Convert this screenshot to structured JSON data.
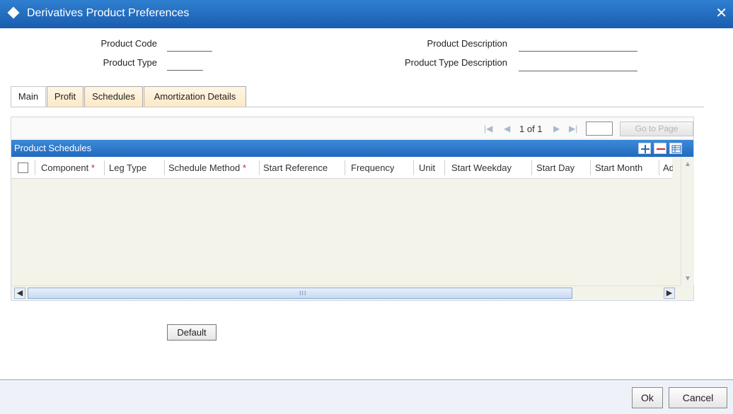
{
  "window": {
    "title": "Derivatives Product Preferences",
    "close_symbol": "✕"
  },
  "header": {
    "product_code_label": "Product Code",
    "product_type_label": "Product Type",
    "product_description_label": "Product Description",
    "product_type_description_label": "Product Type Description"
  },
  "tabs": [
    {
      "label": "Main",
      "active": true
    },
    {
      "label": "Profit",
      "active": false
    },
    {
      "label": "Schedules",
      "active": false
    },
    {
      "label": "Amortization Details",
      "active": false
    }
  ],
  "pager": {
    "first_icon": "first-page-icon",
    "prev_icon": "previous-page-icon",
    "page_text": "1 of 1",
    "next_icon": "next-page-icon",
    "last_icon": "last-page-icon",
    "go_label": "Go to Page"
  },
  "grid": {
    "title": "Product Schedules",
    "columns": [
      {
        "label": "Component",
        "required": true
      },
      {
        "label": "Leg Type",
        "required": false
      },
      {
        "label": "Schedule Method",
        "required": true
      },
      {
        "label": "Start Reference",
        "required": false
      },
      {
        "label": "Frequency",
        "required": false
      },
      {
        "label": "Unit",
        "required": false
      },
      {
        "label": "Start Weekday",
        "required": false
      },
      {
        "label": "Start Day",
        "required": false
      },
      {
        "label": "Start Month",
        "required": false
      },
      {
        "label": "Ad",
        "required": false
      }
    ],
    "required_marker": "*",
    "rows": [],
    "hscroll_grip": "III"
  },
  "actions": {
    "default_label": "Default",
    "ok_label": "Ok",
    "cancel_label": "Cancel"
  },
  "colors": {
    "titlebar": "#1a5db0",
    "section_header": "#2369be",
    "required": "#d42020",
    "tab_inactive": "#fce9c6",
    "grid_body": "#f3f3ea"
  }
}
